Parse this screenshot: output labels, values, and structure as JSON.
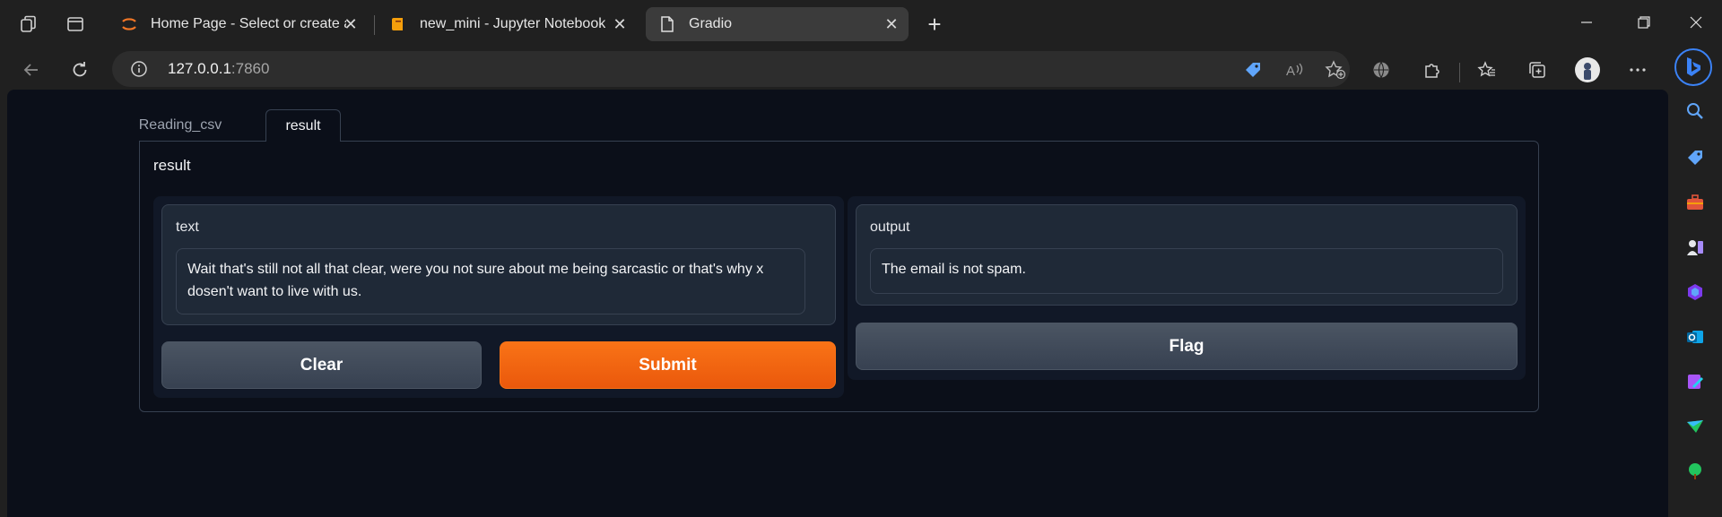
{
  "browser": {
    "tabs": [
      {
        "title": "Home Page - Select or create a n",
        "icon": "jupyter-icon"
      },
      {
        "title": "new_mini - Jupyter Notebook",
        "icon": "notebook-icon"
      },
      {
        "title": "Gradio",
        "icon": "page-icon"
      }
    ],
    "url": {
      "host": "127.0.0.1",
      "port": ":7860"
    }
  },
  "app": {
    "tabs": [
      "Reading_csv",
      "result"
    ],
    "selected_tab": "result",
    "panel_title": "result",
    "input": {
      "label": "text",
      "value": "Wait that's still not all that clear, were you not sure about me being sarcastic or that's why x dosen't want to live with us."
    },
    "output": {
      "label": "output",
      "value": "The email is not spam."
    },
    "buttons": {
      "clear": "Clear",
      "submit": "Submit",
      "flag": "Flag"
    }
  },
  "colors": {
    "accent": "#f97316",
    "background": "#0b0f19",
    "block": "#1f2937"
  }
}
